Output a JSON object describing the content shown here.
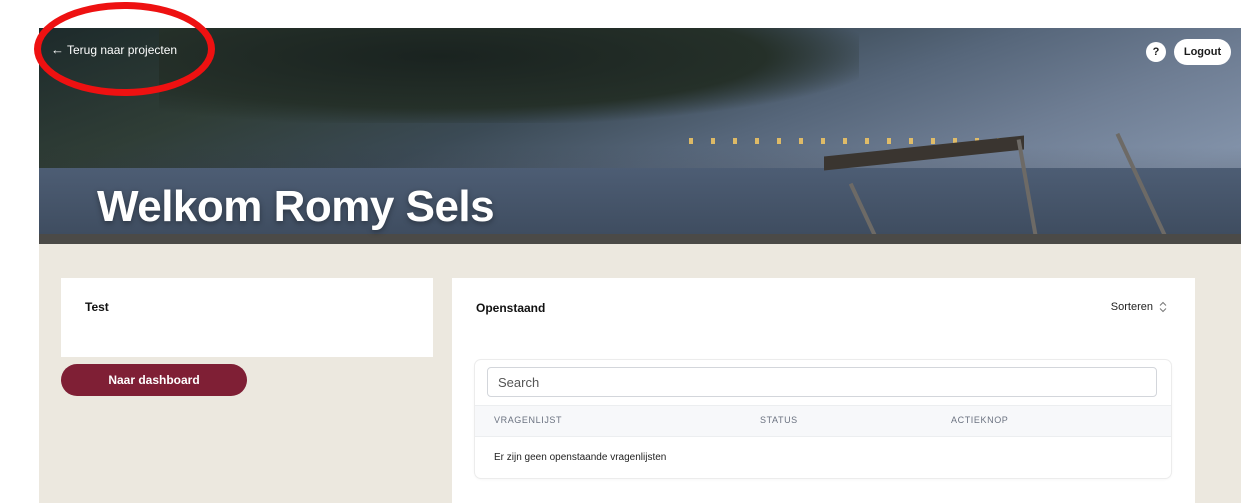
{
  "header": {
    "back_label": "Terug naar projecten",
    "help_label": "?",
    "logout_label": "Logout",
    "welcome_text": "Welkom Romy Sels"
  },
  "sidebar": {
    "project_title": "Test",
    "dashboard_button": "Naar dashboard"
  },
  "main": {
    "title": "Openstaand",
    "sort_label": "Sorteren",
    "search_placeholder": "Search",
    "columns": [
      "VRAGENLIJST",
      "STATUS",
      "ACTIEKNOP"
    ],
    "empty_message": "Er zijn geen openstaande vragenlijsten"
  },
  "colors": {
    "brand": "#7f1f35",
    "background": "#ece8df",
    "annotation": "#ee1111"
  },
  "icons": {
    "back": "arrow-left-icon",
    "sort": "sort-updown-icon"
  }
}
